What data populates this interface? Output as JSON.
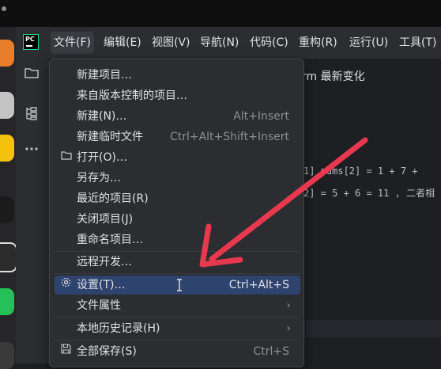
{
  "menubar": {
    "items": [
      {
        "label": "文件(F)"
      },
      {
        "label": "编辑(E)"
      },
      {
        "label": "视图(V)"
      },
      {
        "label": "导航(N)"
      },
      {
        "label": "代码(C)"
      },
      {
        "label": "重构(R)"
      },
      {
        "label": "运行(U)"
      },
      {
        "label": "工具(T)"
      }
    ],
    "logo_text": "PC"
  },
  "editor": {
    "tab_title": "rm 最新变化",
    "code_line_1": "1]   nums[2] = 1 + 7 +",
    "code_line_2": "2] = 5 + 6 = 11 , 二者相"
  },
  "file_menu": {
    "items": [
      {
        "label": "新建项目…",
        "shortcut": "",
        "submenu": false,
        "icon": ""
      },
      {
        "label": "来自版本控制的项目…",
        "shortcut": "",
        "submenu": false,
        "icon": ""
      },
      {
        "label": "新建(N)…",
        "shortcut": "Alt+Insert",
        "submenu": false,
        "icon": ""
      },
      {
        "label": "新建临时文件",
        "shortcut": "Ctrl+Alt+Shift+Insert",
        "submenu": false,
        "icon": ""
      },
      {
        "label": "打开(O)…",
        "shortcut": "",
        "submenu": false,
        "icon": "folder-icon"
      },
      {
        "label": "另存为…",
        "shortcut": "",
        "submenu": false,
        "icon": ""
      },
      {
        "label": "最近的项目(R)",
        "shortcut": "",
        "submenu": true,
        "icon": ""
      },
      {
        "label": "关闭项目(J)",
        "shortcut": "",
        "submenu": false,
        "icon": ""
      },
      {
        "label": "重命名项目…",
        "shortcut": "",
        "submenu": false,
        "icon": ""
      },
      {
        "label": "远程开发…",
        "shortcut": "",
        "submenu": false,
        "icon": ""
      },
      {
        "label": "设置(T)…",
        "shortcut": "Ctrl+Alt+S",
        "submenu": false,
        "icon": "gear-icon",
        "selected": true
      },
      {
        "label": "文件属性",
        "shortcut": "",
        "submenu": true,
        "icon": ""
      },
      {
        "label": "本地历史记录(H)",
        "shortcut": "",
        "submenu": true,
        "icon": ""
      },
      {
        "label": "全部保存(S)",
        "shortcut": "Ctrl+S",
        "submenu": false,
        "icon": "save-icon"
      }
    ]
  },
  "colors": {
    "selection": "#2e436e",
    "annotation_arrow": "#e8384f",
    "menu_bg": "#2b2d30"
  }
}
